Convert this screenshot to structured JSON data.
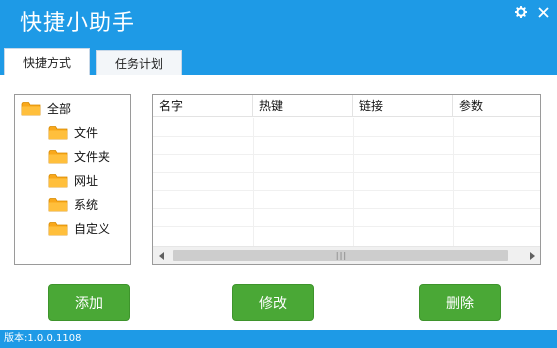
{
  "app": {
    "title": "快捷小助手",
    "controls": [
      {
        "name": "settings",
        "icon": "gear-icon"
      },
      {
        "name": "close",
        "icon": "close-icon"
      }
    ]
  },
  "tabs": [
    {
      "label": "快捷方式",
      "active": true
    },
    {
      "label": "任务计划",
      "active": false
    }
  ],
  "tree": {
    "root": "全部",
    "children": [
      "文件",
      "文件夹",
      "网址",
      "系统",
      "自定义"
    ]
  },
  "grid": {
    "columns": [
      "名字",
      "热键",
      "链接",
      "参数"
    ],
    "rows": []
  },
  "buttons": {
    "add": "添加",
    "edit": "修改",
    "delete": "删除"
  },
  "status": {
    "version": "版本:1.0.0.1108"
  },
  "colors": {
    "titlebar": "#1e9ae6",
    "button": "#4aa836",
    "folder": "#f9a81b"
  }
}
